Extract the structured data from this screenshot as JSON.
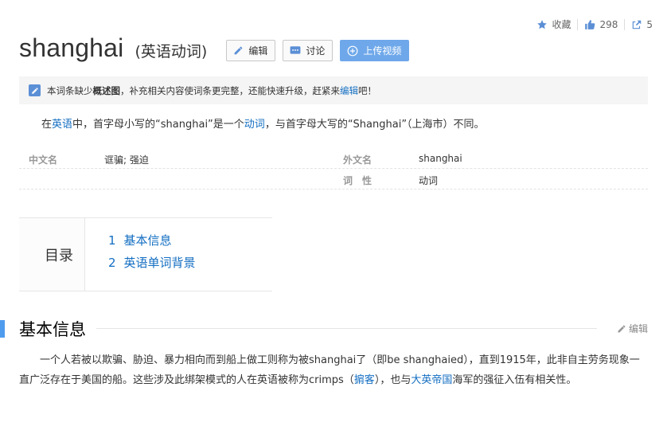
{
  "top_actions": {
    "favorite_label": "收藏",
    "like_count": "298",
    "share_count": "5"
  },
  "title": {
    "word": "shanghai",
    "subtitle": "(英语动词)"
  },
  "buttons": {
    "edit": "编辑",
    "discuss": "讨论",
    "upload_video": "上传视频"
  },
  "notice": {
    "text_before": "本词条缺少",
    "bold": "概述图",
    "text_middle": "，补充相关内容使词条更完整，还能快速升级，赶紧来",
    "link": "编辑",
    "text_after": "吧！"
  },
  "summary": {
    "p1": "在",
    "link1": "英语",
    "p2": "中，首字母小写的“shanghai”是一个",
    "link2": "动词",
    "p3": "，与首字母大写的“Shanghai”（上海市）不同。"
  },
  "info": [
    {
      "k1": "中文名",
      "v1": "诓骗; 强迫",
      "k2": "外文名",
      "v2": "shanghai"
    },
    {
      "k1": "",
      "v1": "",
      "k2": "词　性",
      "v2": "动词"
    }
  ],
  "toc": {
    "title": "目录",
    "items": [
      {
        "num": "1",
        "label": "基本信息"
      },
      {
        "num": "2",
        "label": "英语单词背景"
      }
    ]
  },
  "section": {
    "heading": "基本信息",
    "edit_label": "编辑"
  },
  "paragraph": {
    "p1": "一个人若被以欺骗、胁迫、暴力相向而到船上做工则称为被shanghai了（即be shanghaied），直到1915年，此非自主劳务现象一直广泛存在于美国的船。这些涉及此绑架模式的人在英语被称为crimps（",
    "link1": "掮客",
    "p2": "），也与",
    "link2": "大英帝国",
    "p3": "海军的强征入伍有相关性。"
  },
  "colors": {
    "link": "#136ec2",
    "accent": "#4f9cee",
    "primary_button": "#6fa8ea"
  }
}
